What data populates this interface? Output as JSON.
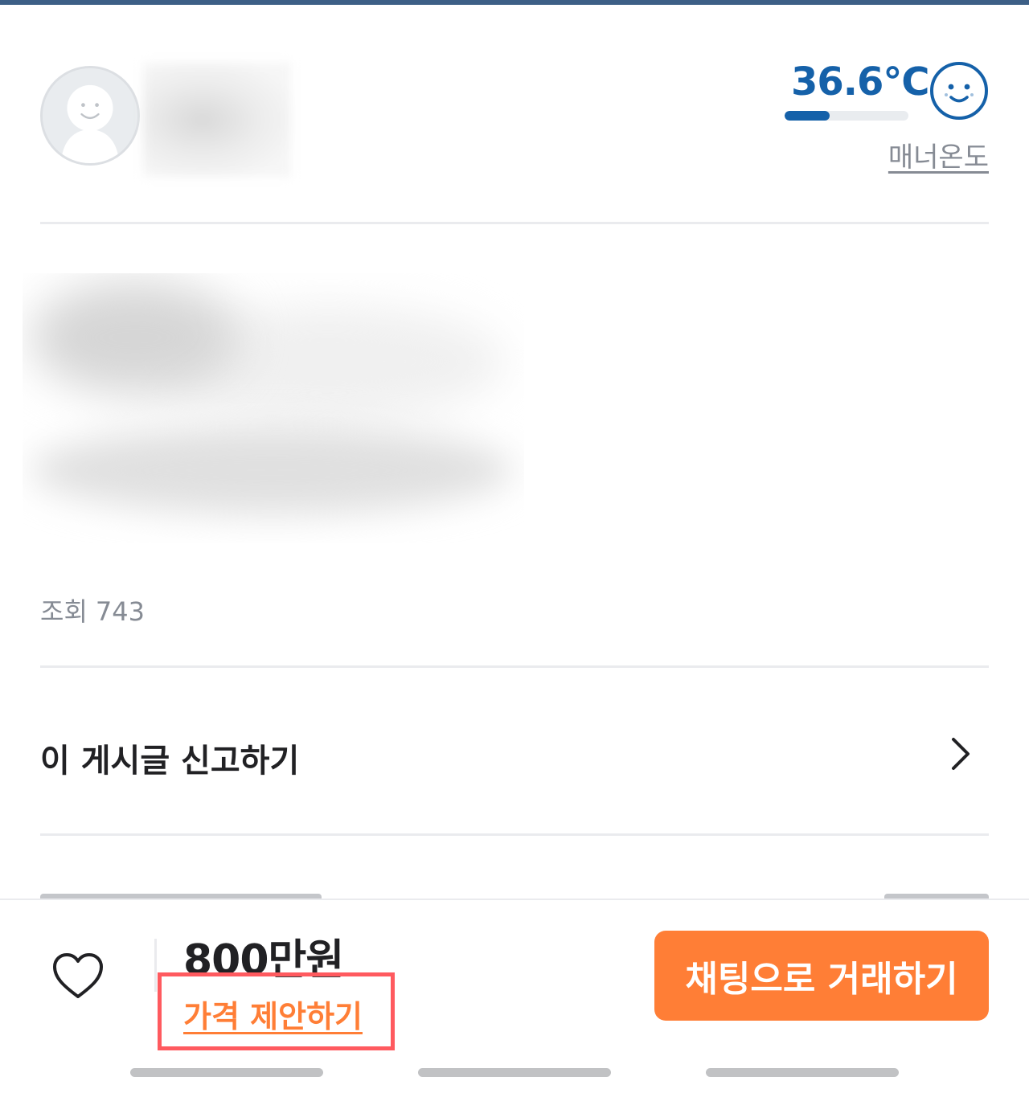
{
  "profile": {
    "manner_temperature": "36.6℃",
    "manner_level": 0.366,
    "manner_label": "매너온도",
    "accent_color": "#1561a9"
  },
  "post": {
    "views_label": "조회",
    "views_count": "743"
  },
  "report": {
    "label": "이 게시글 신고하기"
  },
  "bottom_bar": {
    "price": "800만원",
    "price_offer_label": "가격 제안하기",
    "chat_button_label": "채팅으로 거래하기",
    "brand_color": "#ff7e36",
    "highlight_color": "#ff5a5f"
  },
  "icons": [
    "avatar-placeholder-icon",
    "manner-face-icon",
    "chevron-right-icon",
    "heart-icon"
  ]
}
